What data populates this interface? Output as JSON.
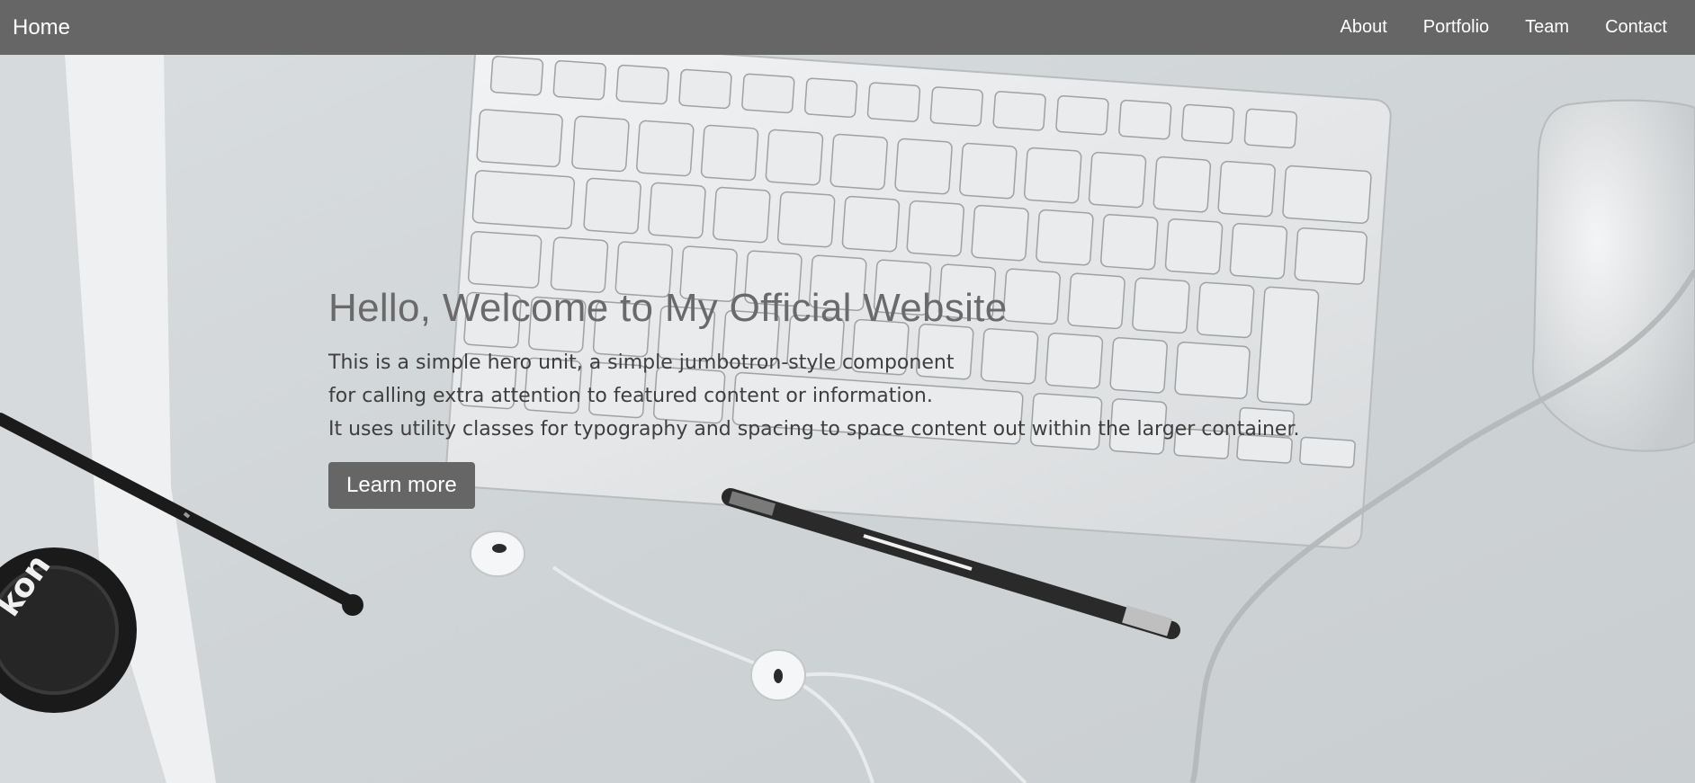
{
  "navbar": {
    "brand": "Home",
    "links": [
      {
        "label": "About"
      },
      {
        "label": "Portfolio"
      },
      {
        "label": "Team"
      },
      {
        "label": "Contact"
      }
    ]
  },
  "hero": {
    "title": "Hello, Welcome to My Official Website",
    "lead_lines": [
      "This is a simple hero unit, a simple jumbotron-style component",
      "for calling extra attention to featured content or information.",
      "It uses utility classes for typography and spacing to space content out within the larger container."
    ],
    "button_label": "Learn more",
    "lens_cap_text": "kon"
  },
  "colors": {
    "navbar_bg": "#666666",
    "button_bg": "#666666",
    "title_color": "#6a6a6a",
    "text_color": "#3e3e3e"
  }
}
